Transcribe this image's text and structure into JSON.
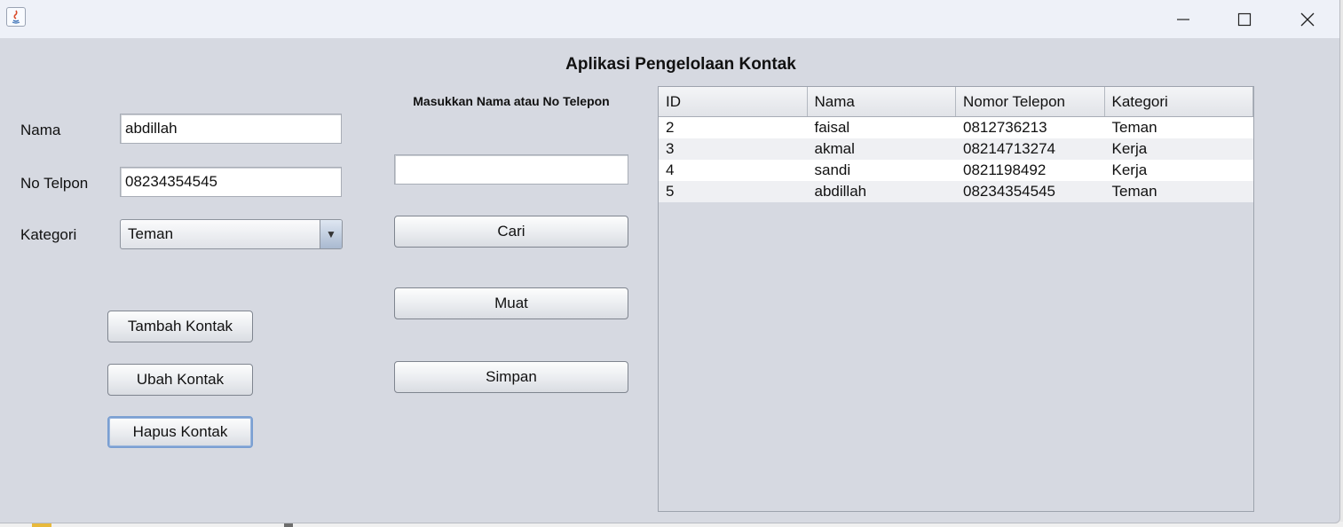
{
  "window": {
    "title": "Aplikasi Pengelolaan Kontak",
    "controls": {
      "minimize": "minimize-icon",
      "maximize": "maximize-icon",
      "close": "close-icon"
    }
  },
  "form": {
    "nama_label": "Nama",
    "nama_value": "abdillah",
    "telpon_label": "No Telpon",
    "telpon_value": "08234354545",
    "kategori_label": "Kategori",
    "kategori_value": "Teman"
  },
  "actions": {
    "tambah": "Tambah Kontak",
    "ubah": "Ubah Kontak",
    "hapus": "Hapus Kontak"
  },
  "search": {
    "label": "Masukkan Nama atau No Telepon",
    "value": "",
    "cari": "Cari",
    "muat": "Muat",
    "simpan": "Simpan"
  },
  "table": {
    "headers": [
      "ID",
      "Nama",
      "Nomor Telepon",
      "Kategori"
    ],
    "rows": [
      [
        "2",
        "faisal",
        "0812736213",
        "Teman"
      ],
      [
        "3",
        "akmal",
        "08214713274",
        "Kerja"
      ],
      [
        "4",
        "sandi",
        "0821198492",
        "Kerja"
      ],
      [
        "5",
        "abdillah",
        "08234354545",
        "Teman"
      ]
    ]
  }
}
